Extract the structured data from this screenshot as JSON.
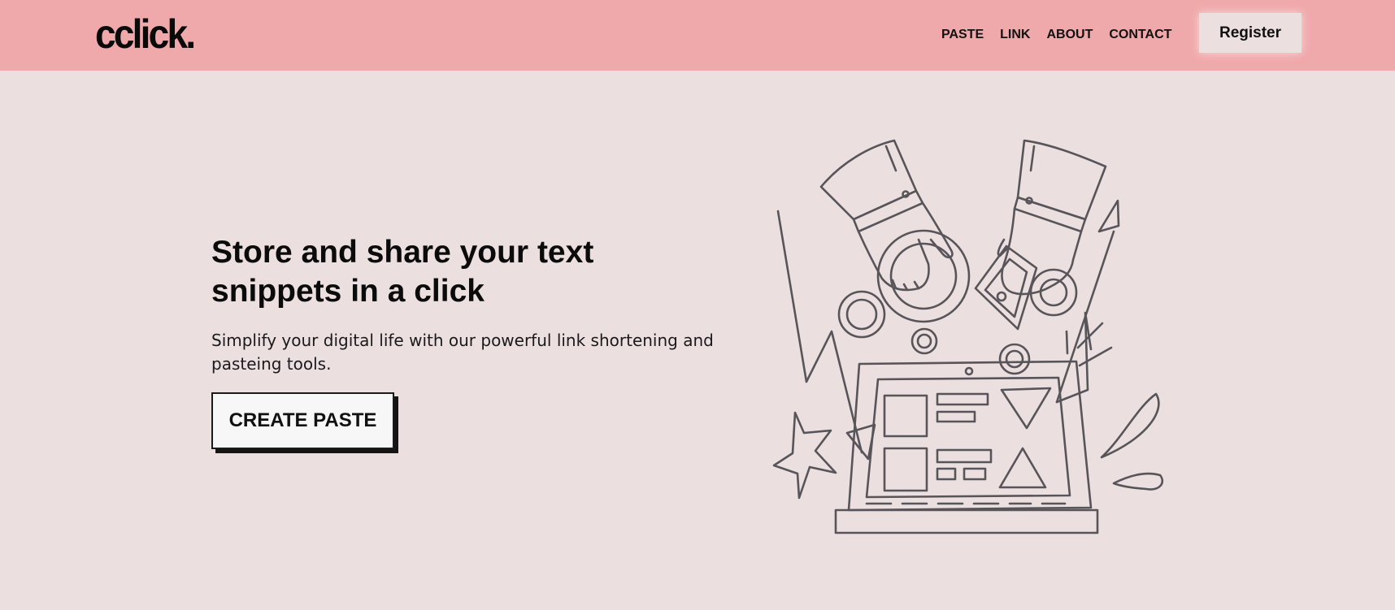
{
  "header": {
    "logo": "cclick.",
    "nav": [
      "PASTE",
      "LINK",
      "ABOUT",
      "CONTACT"
    ],
    "register_label": "Register"
  },
  "hero": {
    "title": "Store and share your text snippets in a click",
    "subtitle": "Simplify your digital life with our powerful link shortening and pasteing tools.",
    "cta_label": "CREATE PASTE"
  },
  "colors": {
    "navbar": "#f0a9ab",
    "background": "#ecdfdf",
    "text": "#111111",
    "illustration_stroke": "#575559"
  }
}
